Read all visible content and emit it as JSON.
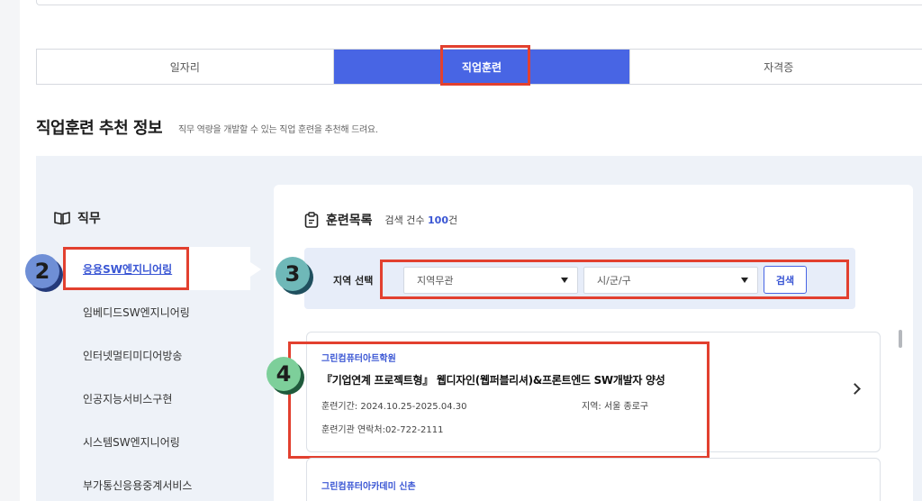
{
  "tabs": [
    {
      "label": "일자리",
      "active": false
    },
    {
      "label": "직업훈련",
      "active": true
    },
    {
      "label": "자격증",
      "active": false
    }
  ],
  "section": {
    "title": "직업훈련 추천 정보",
    "desc": "직무 역량을 개발할 수 있는 직업 훈련을 추천해 드려요."
  },
  "jobs": {
    "heading": "직무",
    "icon": "book-icon",
    "items": [
      {
        "label": "응용SW엔지니어링",
        "active": true
      },
      {
        "label": "임베디드SW엔지니어링",
        "active": false
      },
      {
        "label": "인터넷멀티미디어방송",
        "active": false
      },
      {
        "label": "인공지능서비스구현",
        "active": false
      },
      {
        "label": "시스템SW엔지니어링",
        "active": false
      },
      {
        "label": "부가통신응용중계서비스",
        "active": false
      }
    ]
  },
  "training": {
    "title": "훈련목록",
    "icon": "clipboard-icon",
    "count_prefix": "검색 건수",
    "count_value": "100",
    "count_suffix": "건"
  },
  "filter": {
    "label": "지역 선택",
    "region_select": "지역무관",
    "city_select": "시/군/구",
    "search_label": "검색"
  },
  "results": [
    {
      "institution": "그린컴퓨터아트학원",
      "title": "『기업연계 프로젝트형』 웹디자인(웹퍼블리셔)&프론트엔드 SW개발자 양성",
      "period": "훈련기간: 2024.10.25-2025.04.30",
      "region": "지역: 서울 종로구",
      "contact": "훈련기관 연락처:02-722-2111"
    },
    {
      "institution": "그린컴퓨터아카데미 신촌"
    }
  ],
  "badges": [
    "2",
    "3",
    "4"
  ],
  "colors": {
    "accent": "#4865e4",
    "highlight": "#e2402f",
    "panel_bg": "#eef2f8"
  }
}
